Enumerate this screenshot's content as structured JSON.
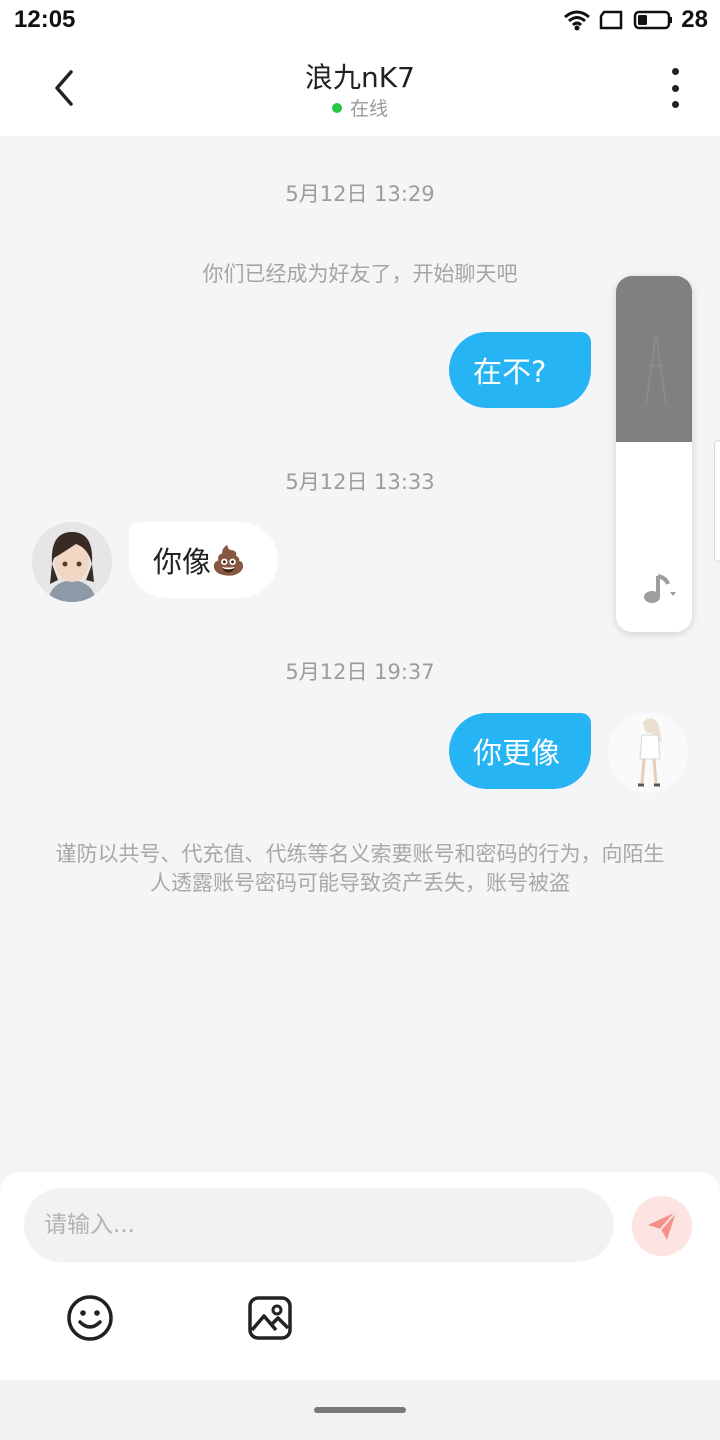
{
  "status_bar": {
    "time": "12:05",
    "battery": "28"
  },
  "header": {
    "title": "浪九nK7",
    "status": "在线",
    "colors": {
      "online": "#28c840"
    }
  },
  "chat": {
    "messages": [
      {
        "type": "timestamp",
        "text": "5月12日 13:29"
      },
      {
        "type": "system",
        "text": "你们已经成为好友了，开始聊天吧"
      },
      {
        "type": "outgoing",
        "text": "在不?"
      },
      {
        "type": "timestamp",
        "text": "5月12日 13:33"
      },
      {
        "type": "incoming",
        "text": "你像",
        "emoji": "💩"
      },
      {
        "type": "timestamp",
        "text": "5月12日 19:37"
      },
      {
        "type": "outgoing",
        "text": "你更像"
      }
    ],
    "warning": "谨防以共号、代充值、代练等名义索要账号和密码的行为，向陌生人透露账号密码可能导致资产丢失，账号被盗"
  },
  "input": {
    "placeholder": "请输入..."
  },
  "icons": [
    "back-icon",
    "more-icon",
    "wifi-icon",
    "sim-icon",
    "battery-icon",
    "music-note-icon",
    "send-icon",
    "smiley-icon",
    "image-icon"
  ],
  "colors": {
    "outgoing_bubble": "#27b4f5",
    "send_button": "#f49188",
    "background": "#f4f5f7"
  }
}
